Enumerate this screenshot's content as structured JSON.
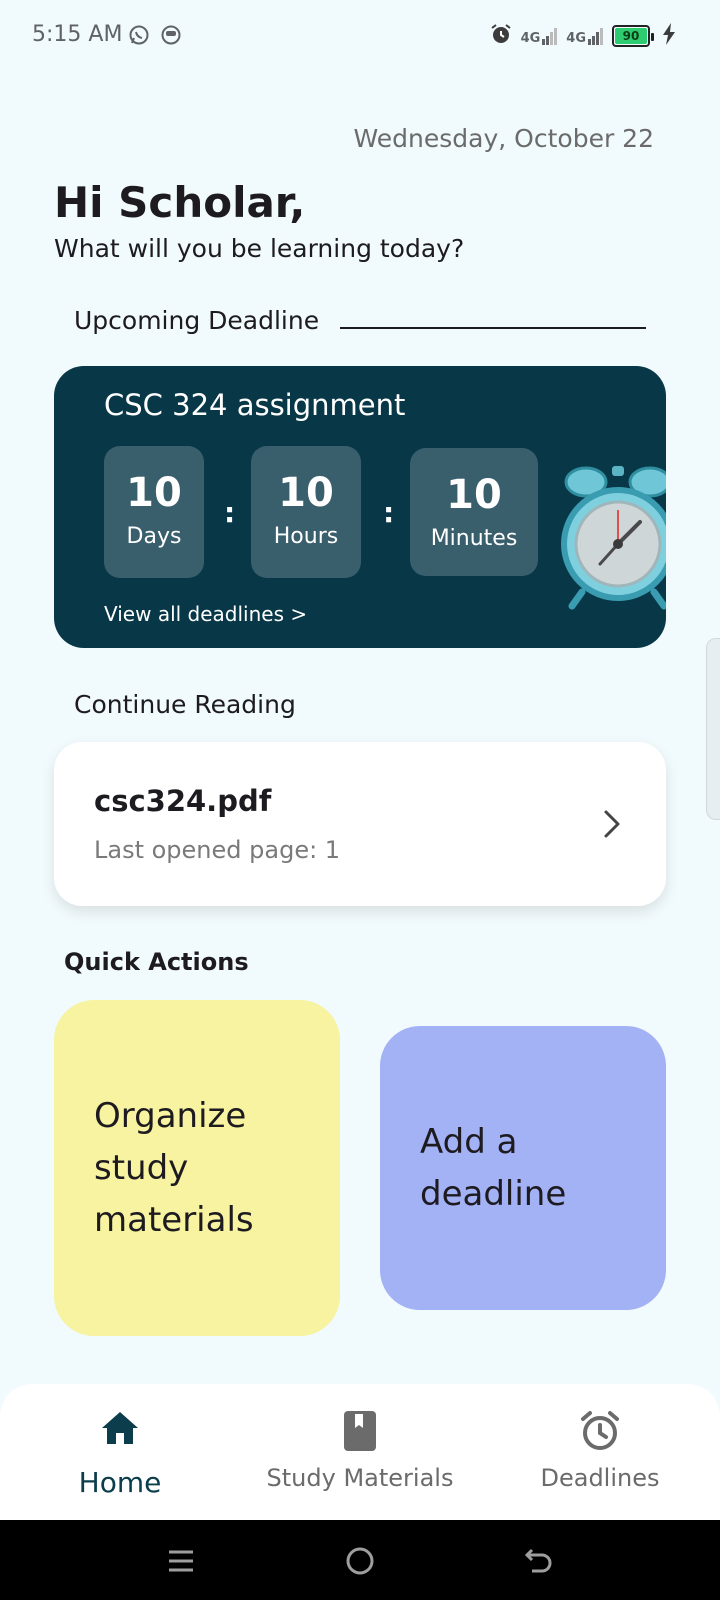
{
  "status_bar": {
    "time": "5:15 AM",
    "network_1": "4G",
    "network_2": "4G",
    "battery": "90",
    "icons": [
      "whatsapp-icon",
      "app-icon",
      "alarm-icon",
      "signal-icon",
      "battery-icon",
      "charging-icon"
    ]
  },
  "date": "Wednesday, October 22",
  "greeting": {
    "title": "Hi Scholar,",
    "subtitle": "What will you be learning today?"
  },
  "upcoming": {
    "label": "Upcoming Deadline",
    "title": "CSC 324 assignment",
    "days_value": "10",
    "days_label": "Days",
    "hours_value": "10",
    "hours_label": "Hours",
    "minutes_value": "10",
    "minutes_label": "Minutes",
    "separator": ":",
    "view_all": "View all deadlines >",
    "card_color": "#083848"
  },
  "continue_reading": {
    "label": "Continue Reading",
    "file_name": "csc324.pdf",
    "last_opened": "Last opened page: 1"
  },
  "quick_actions": {
    "label": "Quick Actions",
    "organize": "Organize study materials",
    "add_deadline": "Add a deadline",
    "organize_color": "#f7f3a1",
    "add_color": "#a3b1f5"
  },
  "bottom_nav": {
    "items": [
      {
        "label": "Home",
        "icon": "home-icon",
        "active": true
      },
      {
        "label": "Study Materials",
        "icon": "book-icon",
        "active": false
      },
      {
        "label": "Deadlines",
        "icon": "alarm-clock-icon",
        "active": false
      }
    ]
  }
}
